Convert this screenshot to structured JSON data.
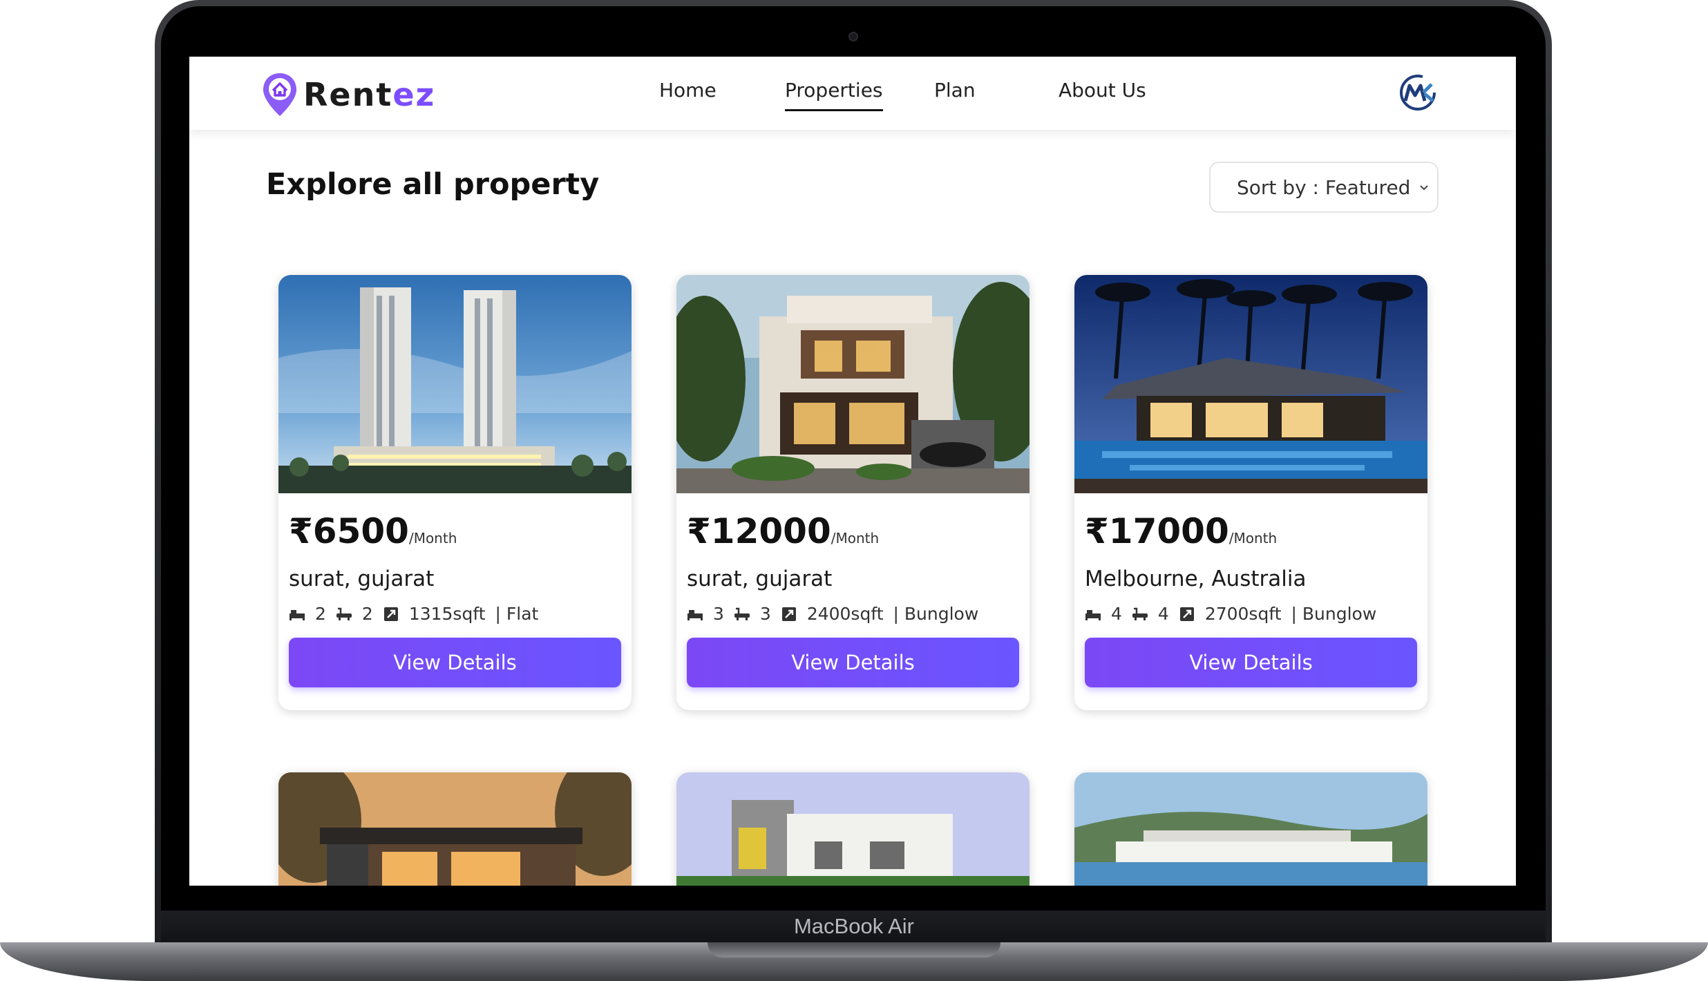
{
  "device": {
    "label": "MacBook Air"
  },
  "brand": {
    "name_main": "Rent",
    "name_accent": "ez",
    "accent_color": "#7c4dff"
  },
  "nav": {
    "items": [
      {
        "label": "Home",
        "active": false
      },
      {
        "label": "Properties",
        "active": true
      },
      {
        "label": "Plan",
        "active": false
      },
      {
        "label": "About Us",
        "active": false
      }
    ]
  },
  "user": {
    "avatar_initials": "MK"
  },
  "page": {
    "title": "Explore all property"
  },
  "sort": {
    "selected": "Sort by : Featured"
  },
  "button_color": "#7c48f5",
  "cards": [
    {
      "price": "₹6500",
      "period": "/Month",
      "location": "surat, gujarat",
      "beds": "2",
      "baths": "2",
      "area": "1315sqft",
      "type": "| Flat",
      "button": "View Details",
      "image": "twin-towers"
    },
    {
      "price": "₹12000",
      "period": "/Month",
      "location": "surat, gujarat",
      "beds": "3",
      "baths": "3",
      "area": "2400sqft",
      "type": "| Bunglow",
      "button": "View Details",
      "image": "modern-villa"
    },
    {
      "price": "₹17000",
      "period": "/Month",
      "location": "Melbourne, Australia",
      "beds": "4",
      "baths": "4",
      "area": "2700sqft",
      "type": "| Bunglow",
      "button": "View Details",
      "image": "pool-resort"
    }
  ]
}
